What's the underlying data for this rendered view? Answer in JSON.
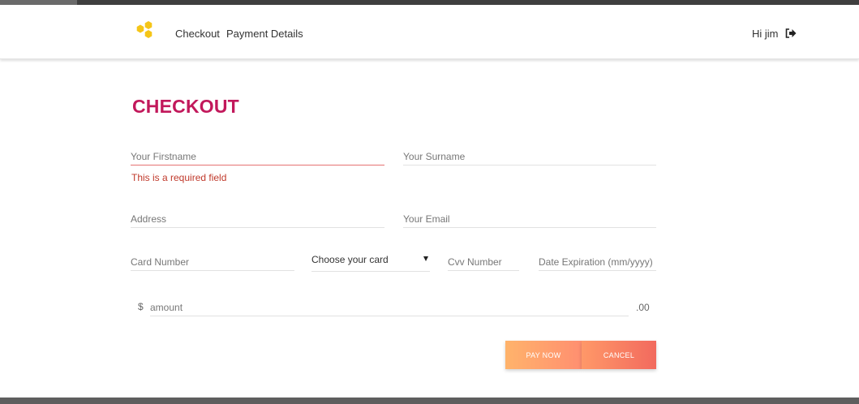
{
  "nav": {
    "checkout": "Checkout",
    "payment_details": "Payment Details",
    "greeting": "Hi jim"
  },
  "page": {
    "title": "CHECKOUT"
  },
  "form": {
    "firstname_placeholder": "Your Firstname",
    "firstname_error": "This is a required field",
    "surname_placeholder": "Your Surname",
    "address_placeholder": "Address",
    "email_placeholder": "Your Email",
    "card_number_placeholder": "Card Number",
    "card_select_label": "Choose your card",
    "cvv_placeholder": "Cvv Number",
    "expiration_placeholder": "Date Expiration (mm/yyyy)",
    "currency_symbol": "$",
    "amount_placeholder": "amount",
    "cents_suffix": ".00"
  },
  "buttons": {
    "pay_now": "PAY NOW",
    "cancel": "CANCEL"
  },
  "icons": {
    "logo": "honeycomb-logo-icon",
    "logout": "sign-out-icon"
  },
  "colors": {
    "title": "#c2185b",
    "logo": "#f5c518",
    "error": "#c0392b",
    "pay_gradient": [
      "#ffb36b",
      "#ff8f70"
    ],
    "cancel_gradient": [
      "#ff9868",
      "#f26a5e"
    ]
  }
}
